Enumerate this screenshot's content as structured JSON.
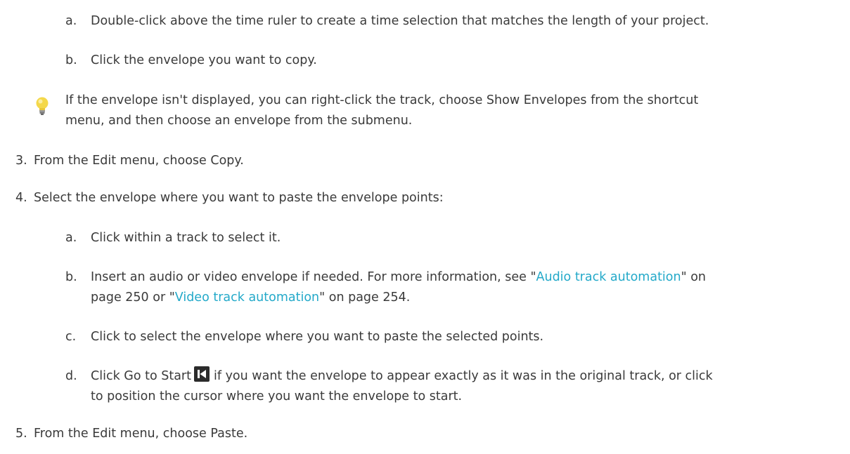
{
  "steps": {
    "s2a": {
      "marker": "a.",
      "text": "Double-click above the time ruler to create a time selection that matches the length of your project."
    },
    "s2b": {
      "marker": "b.",
      "text": "Click the envelope you want to copy."
    },
    "tip": {
      "icon": "lightbulb-icon",
      "line1": "If the envelope isn't displayed, you can right-click the track, choose Show Envelopes from the shortcut",
      "line2": "menu, and then choose an envelope from the submenu."
    },
    "s3": {
      "marker": "3.",
      "text": "From the Edit menu, choose Copy."
    },
    "s4": {
      "marker": "4.",
      "text": "Select the envelope where you want to paste the envelope points:"
    },
    "s4a": {
      "marker": "a.",
      "text": "Click within a track to select it."
    },
    "s4b": {
      "marker": "b.",
      "line1_pre": "Insert an audio or video envelope if needed. For more information, see \"",
      "link1": "Audio track automation",
      "line1_post": "\" on",
      "line2_pre": "page 250 or \"",
      "link2": "Video track automation",
      "line2_post": "\" on page 254."
    },
    "s4c": {
      "marker": "c.",
      "text": "Click to select the envelope where you want to paste the selected points."
    },
    "s4d": {
      "marker": "d.",
      "line1_pre": "Click Go to Start",
      "icon": "go-to-start-icon",
      "line1_post": "if you want the envelope to appear exactly as it was in the original track, or click",
      "line2": "to position the cursor where you want the envelope to start."
    },
    "s5": {
      "marker": "5.",
      "text": "From the Edit menu, choose Paste."
    }
  },
  "colors": {
    "text": "#3a3a3a",
    "link": "#23a9c9",
    "tip_bulb": "#f4d84a"
  }
}
